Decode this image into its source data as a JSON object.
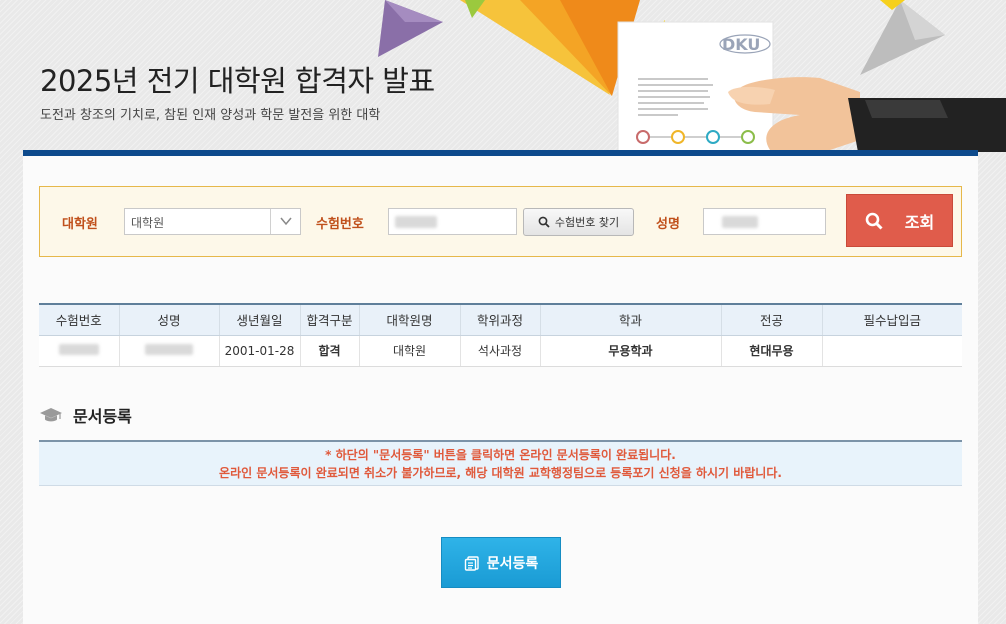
{
  "header": {
    "title": "2025년 전기 대학원 합격자 발표",
    "subtitle": "도전과 창조의 기치로, 참된 인재 양성과 학문 발전을 위한 대학",
    "logo_text": "DKU"
  },
  "search": {
    "graduate_label": "대학원",
    "graduate_value": "대학원",
    "exam_no_label": "수험번호",
    "find_button": "수험번호 찾기",
    "name_label": "성명",
    "query_button": "조회"
  },
  "table": {
    "headers": [
      "수험번호",
      "성명",
      "생년월일",
      "합격구분",
      "대학원명",
      "학위과정",
      "학과",
      "전공",
      "필수납입금"
    ],
    "row": {
      "birth": "2001-01-28",
      "result": "합격",
      "graduate": "대학원",
      "degree": "석사과정",
      "department": "무용학과",
      "major": "현대무용",
      "fee": ""
    }
  },
  "documents": {
    "section_title": "문서등록",
    "notice_line1": "* 하단의 \"문서등록\" 버튼을 클릭하면 온라인 문서등록이 완료됩니다.",
    "notice_line2": "온라인 문서등록이 완료되면 취소가 불가하므로, 해당 대학원 교학행정팀으로 등록포기 신청을 하시기 바랍니다.",
    "register_button": "문서등록"
  },
  "colors": {
    "accent_blue": "#0d4a8c",
    "label_orange": "#c0501b",
    "query_red": "#e05c4b",
    "register_blue": "#1a9bd4",
    "notice_text": "#e0593b"
  }
}
